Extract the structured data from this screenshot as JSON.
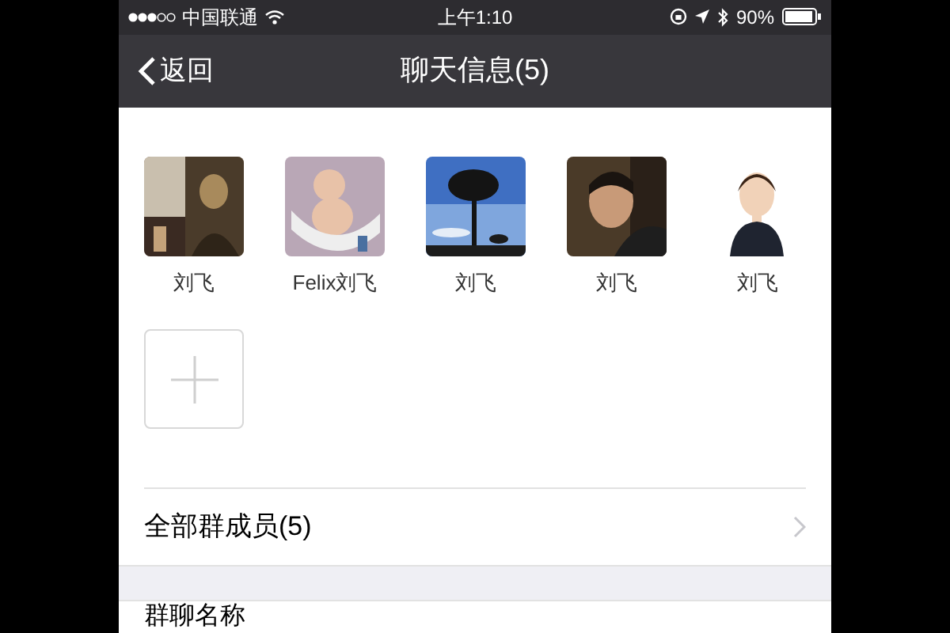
{
  "status_bar": {
    "carrier": "中国联通",
    "time": "上午1:10",
    "battery": "90%"
  },
  "nav": {
    "back": "返回",
    "title": "聊天信息(5)"
  },
  "members": [
    {
      "name": "刘飞"
    },
    {
      "name": "Felix刘飞"
    },
    {
      "name": "刘飞"
    },
    {
      "name": "刘飞"
    },
    {
      "name": "刘飞"
    }
  ],
  "rows": [
    {
      "label": "全部群成员(5)"
    },
    {
      "label": "群聊名称"
    }
  ]
}
